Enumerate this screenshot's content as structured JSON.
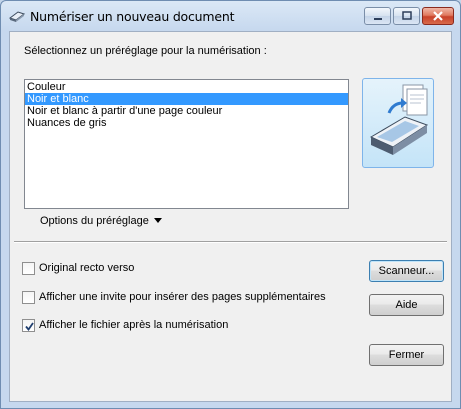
{
  "window": {
    "title": "Numériser un nouveau document"
  },
  "prompt_label": "Sélectionnez un préréglage pour la numérisation :",
  "presets": [
    {
      "label": "Couleur",
      "selected": false
    },
    {
      "label": "Noir et blanc",
      "selected": true
    },
    {
      "label": "Noir et blanc à partir d'une page couleur",
      "selected": false
    },
    {
      "label": "Nuances de gris",
      "selected": false
    }
  ],
  "options_label": "Options du préréglage",
  "checkboxes": [
    {
      "label": "Original recto verso",
      "checked": false
    },
    {
      "label": "Afficher une invite pour insérer des pages supplémentaires",
      "checked": false
    },
    {
      "label": "Afficher le fichier après la numérisation",
      "checked": true
    }
  ],
  "buttons": {
    "scanner": "Scanneur...",
    "help": "Aide",
    "close": "Fermer"
  },
  "icons": {
    "title": "scanner-small-icon",
    "tile": "scanner-pages-icon",
    "caret": "triangle-down-icon"
  },
  "colors": {
    "selection": "#3399ff",
    "close_button": "#c8412a",
    "frame": "#c6d8ee"
  }
}
